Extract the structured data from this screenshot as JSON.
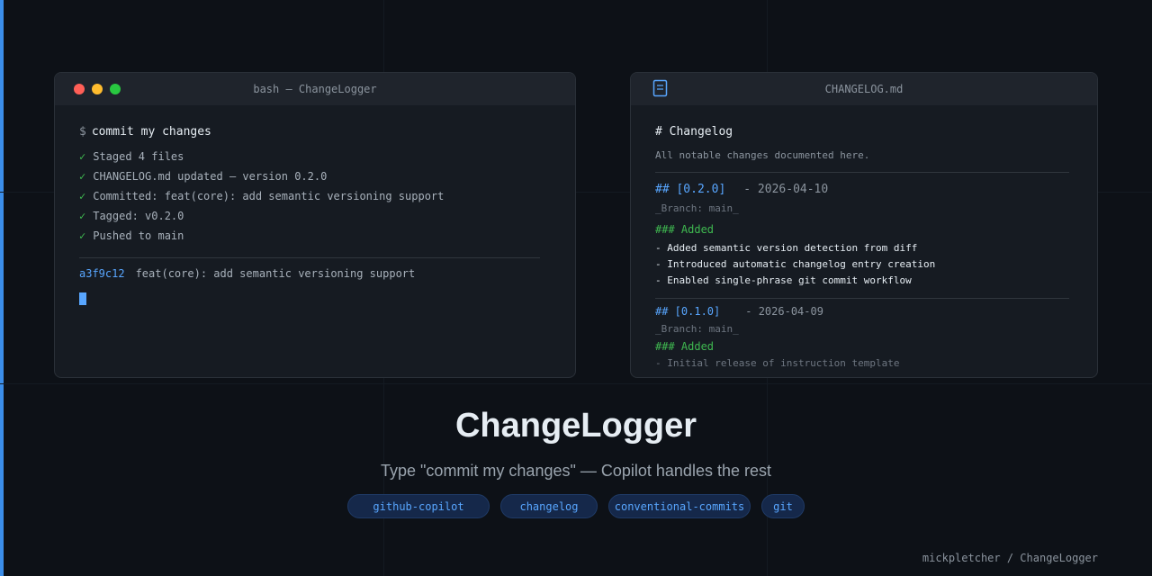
{
  "terminal": {
    "title": "bash — ChangeLogger",
    "prompt_symbol": "$",
    "command": "commit my changes",
    "check_mark": "✓",
    "outputs": [
      "Staged 4 files",
      "CHANGELOG.md updated — version 0.2.0",
      "Committed: feat(core): add semantic versioning support",
      "Tagged: v0.2.0",
      "Pushed to main"
    ],
    "commit_hash": "a3f9c12",
    "commit_message": "feat(core): add semantic versioning support"
  },
  "changelog": {
    "title": "CHANGELOG.md",
    "heading": "# Changelog",
    "note": "All notable changes documented here.",
    "releases": [
      {
        "version": "## [0.2.0]",
        "date": "- 2026-04-10",
        "branch": "_Branch: main_",
        "section": "### Added",
        "items": [
          "- Added semantic version detection from diff",
          "- Introduced automatic changelog entry creation",
          "- Enabled single-phrase git commit workflow"
        ]
      },
      {
        "version": "## [0.1.0]",
        "date": "- 2026-04-09",
        "branch": "_Branch: main_",
        "section": "### Added",
        "items": [
          "- Initial release of instruction template"
        ]
      }
    ]
  },
  "hero": {
    "title": "ChangeLogger",
    "subtitle": "Type \"commit my changes\" — Copilot handles the rest"
  },
  "tags": [
    "github-copilot",
    "changelog",
    "conventional-commits",
    "git"
  ],
  "footer": "mickpletcher / ChangeLogger",
  "colors": {
    "accent": "#3b8eea",
    "background": "#0d1117",
    "link": "#58a6ff",
    "success": "#3fb950"
  }
}
